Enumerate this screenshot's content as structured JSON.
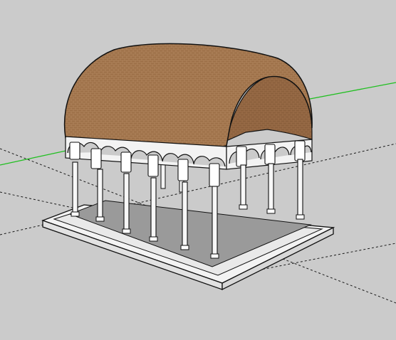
{
  "app": {
    "kind": "3d-modeling-viewport",
    "background_color": "#cbcbcb"
  },
  "scene": {
    "model": "barrel-vaulted-arcade-pavilion",
    "axes": {
      "green_axis_color": "#1fbf1f",
      "hidden_axis_style": "dashed",
      "hidden_axis_color": "#1a1a1a"
    },
    "colors": {
      "vault_texture": "#9c6f47",
      "vault_texture_light": "#b58a61",
      "vault_interior": "#8a5f3c",
      "stone": "#f3f3f3",
      "shadow_stone": "#d7d7d7",
      "floor": "#9a9a9a",
      "edges": "#111111"
    }
  }
}
